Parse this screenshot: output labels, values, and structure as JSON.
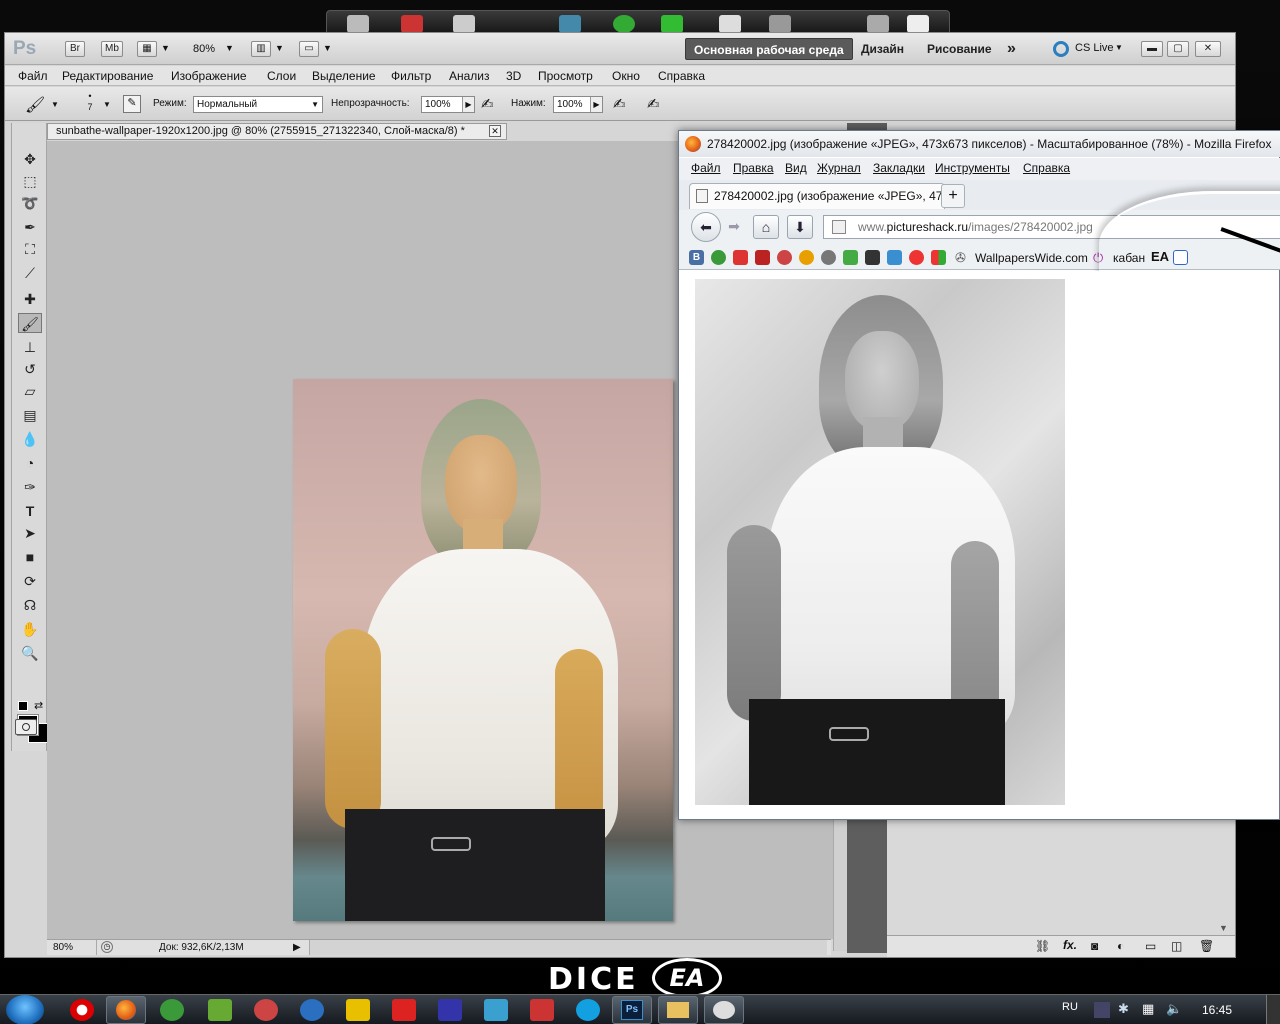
{
  "desktop": {
    "logo_dice": "DICE",
    "logo_ea": "EA"
  },
  "photoshop": {
    "logo": "Ps",
    "appbar": {
      "bridge": "Br",
      "mini_bridge": "Mb",
      "zoom": "80%",
      "workspace_active": "Основная рабочая среда",
      "workspace_design": "Дизайн",
      "workspace_paint": "Рисование",
      "more": "»",
      "cs_live": "CS Live"
    },
    "menu": [
      "Файл",
      "Редактирование",
      "Изображение",
      "Слои",
      "Выделение",
      "Фильтр",
      "Анализ",
      "3D",
      "Просмотр",
      "Окно",
      "Справка"
    ],
    "options": {
      "brush_size": "7",
      "mode_label": "Режим:",
      "mode_value": "Нормальный",
      "opacity_label": "Непрозрачность:",
      "opacity_value": "100%",
      "pressure_label": "Нажим:",
      "pressure_value": "100%"
    },
    "document_tab": "sunbathe-wallpaper-1920x1200.jpg @ 80% (2755915_271322340, Слой-маска/8) *",
    "status": {
      "zoom": "80%",
      "doc_info": "Док: 932,6K/2,13M"
    }
  },
  "firefox": {
    "title": "278420002.jpg (изображение «JPEG», 473x673 пикселов) - Масштабированное (78%) - Mozilla Firefox",
    "menu": [
      "Файл",
      "Правка",
      "Вид",
      "Журнал",
      "Закладки",
      "Инструменты",
      "Справка"
    ],
    "tab_title": "278420002.jpg (изображение «JPEG», 47...",
    "url_domain": "www.",
    "url_host": "pictureshack.ru",
    "url_path": "/images/278420002.jpg",
    "bookmarks": {
      "b_label": "B",
      "wallpaperswide": "WallpapersWide.com",
      "kaban": "кабан",
      "ea": "EA"
    }
  },
  "taskbar": {
    "lang": "RU",
    "clock": "16:45"
  }
}
